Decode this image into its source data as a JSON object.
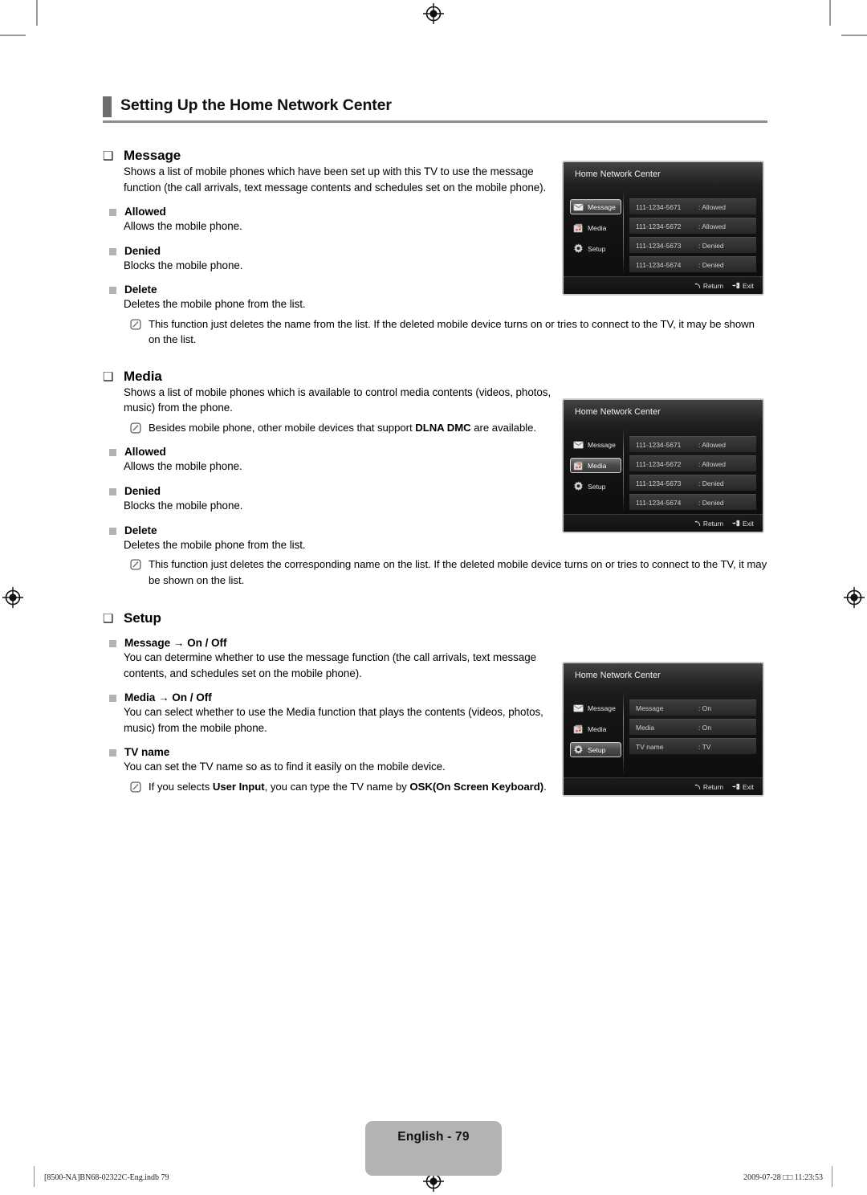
{
  "header": {
    "title": "Setting Up the Home Network Center"
  },
  "sections": [
    {
      "bullet": "❑",
      "title": "Message",
      "paragraphs": [
        "Shows a list of mobile phones which have been set up with this TV to use the message function (the call arrivals, text message contents and schedules set on the mobile phone)."
      ],
      "items": [
        {
          "title": "Allowed",
          "body": "Allows the mobile phone."
        },
        {
          "title": "Denied",
          "body": "Blocks the mobile phone."
        },
        {
          "title": "Delete",
          "body": "Deletes the mobile phone from the list."
        }
      ],
      "note": "This function just deletes the name from the list. If the deleted mobile device turns on or tries to connect to the TV, it may be shown on the list."
    },
    {
      "bullet": "❑",
      "title": "Media",
      "paragraphs": [
        "Shows a list of mobile phones which is available to control media contents (videos, photos, music) from the phone."
      ],
      "top_note_pre": "Besides mobile phone, other mobile devices that support ",
      "top_note_bold": "DLNA DMC",
      "top_note_post": " are available.",
      "items": [
        {
          "title": "Allowed",
          "body": "Allows the mobile phone."
        },
        {
          "title": "Denied",
          "body": "Blocks the mobile phone."
        },
        {
          "title": "Delete",
          "body": "Deletes the mobile phone from the list."
        }
      ],
      "note": "This function just deletes the corresponding name on the list. If the deleted mobile device turns on or tries to connect to the TV, it may be shown on the list."
    },
    {
      "bullet": "❑",
      "title": "Setup",
      "items": [
        {
          "title": "Message → On / Off",
          "body": "You can determine whether to use the message function (the call arrivals, text message contents, and schedules set on the mobile phone)."
        },
        {
          "title": "Media → On / Off",
          "body": "You can select whether to use the Media function that plays the contents (videos, photos, music) from the mobile phone."
        },
        {
          "title": "TV name",
          "body": "You can set the TV name so as to find it easily on the mobile device."
        }
      ],
      "note_parts": {
        "pre": "If you selects ",
        "b1": "User Input",
        "mid": ", you can type the TV name by ",
        "b2": "OSK(On Screen Keyboard)",
        "post": "."
      }
    }
  ],
  "osd": {
    "title": "Home Network Center",
    "nav": [
      {
        "label": "Message",
        "icon": "envelope-icon"
      },
      {
        "label": "Media",
        "icon": "media-icon"
      },
      {
        "label": "Setup",
        "icon": "gear-icon"
      }
    ],
    "footer": [
      {
        "label": "Return",
        "icon": "return-arrow-icon"
      },
      {
        "label": "Exit",
        "icon": "exit-door-icon"
      }
    ],
    "screens": [
      {
        "name": "message-screen",
        "active": "Message",
        "rows": [
          {
            "key": "111-1234-5671",
            "value": ": Allowed"
          },
          {
            "key": "111-1234-5672",
            "value": ": Allowed"
          },
          {
            "key": "111-1234-5673",
            "value": ": Denied"
          },
          {
            "key": "111-1234-5674",
            "value": ": Denied"
          }
        ]
      },
      {
        "name": "media-screen",
        "active": "Media",
        "rows": [
          {
            "key": "111-1234-5671",
            "value": ": Allowed"
          },
          {
            "key": "111-1234-5672",
            "value": ": Allowed"
          },
          {
            "key": "111-1234-5673",
            "value": ": Denied"
          },
          {
            "key": "111-1234-5674",
            "value": ": Denied"
          }
        ]
      },
      {
        "name": "setup-screen",
        "active": "Setup",
        "rows": [
          {
            "key": "Message",
            "value": ": On"
          },
          {
            "key": "Media",
            "value": ": On"
          },
          {
            "key": "TV name",
            "value": ": TV"
          }
        ]
      }
    ]
  },
  "footer": {
    "page_label": "English - 79",
    "file_ref": "[8500-NA]BN68-02322C-Eng.indb   79",
    "timestamp": "2009-07-28   □□ 11:23:53"
  }
}
